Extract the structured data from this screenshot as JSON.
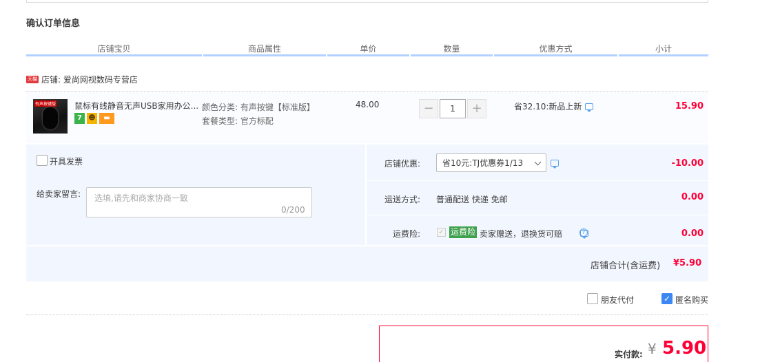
{
  "page": {
    "title": "确认订单信息"
  },
  "columns": [
    "店铺宝贝",
    "商品属性",
    "单价",
    "数量",
    "优惠方式",
    "小计"
  ],
  "shop": {
    "badge": "天猫",
    "label": "店铺: 爱尚网视数码专营店"
  },
  "item": {
    "thumb_tag": "有声按键版",
    "title": "鼠标有线静音无声USB家用办公...",
    "service_icons": [
      "7",
      "badge-icon",
      "card-icon"
    ],
    "attr_color": "颜色分类: 有声按键【标准版】",
    "attr_package": "套餐类型: 官方标配",
    "price": "48.00",
    "quantity": "1",
    "minus": "−",
    "plus": "+",
    "discount": "省32.10:新品上新",
    "subtotal": "15.90"
  },
  "options": {
    "invoice_label": "开具发票",
    "message_label": "给卖家留言:",
    "message_placeholder": "选填,请先和商家协商一致",
    "message_count": "0/200",
    "shop_discount_label": "店铺优惠:",
    "shop_discount_value": "省10元:TJ优惠券1/13",
    "shop_discount_amount": "-10.00",
    "shipping_label": "运送方式:",
    "shipping_value": "普通配送 快递 免邮",
    "shipping_amount": "0.00",
    "insurance_label": "运费险:",
    "insurance_badge": "运费险",
    "insurance_text": "卖家赠送，退换货可赔",
    "insurance_amount": "0.00"
  },
  "summary": {
    "label": "店铺合计(含运费)",
    "value": "¥5.90"
  },
  "extras": {
    "friend_pay": "朋友代付",
    "anonymous": "匿名购买"
  },
  "payment": {
    "label": "实付款:",
    "currency": "¥",
    "value": "5.90"
  },
  "colors": {
    "accent": "#ff0036",
    "header_line": "#b2d1ff",
    "panel_bg": "#f2f7ff",
    "checkbox_blue": "#3b88f5"
  }
}
